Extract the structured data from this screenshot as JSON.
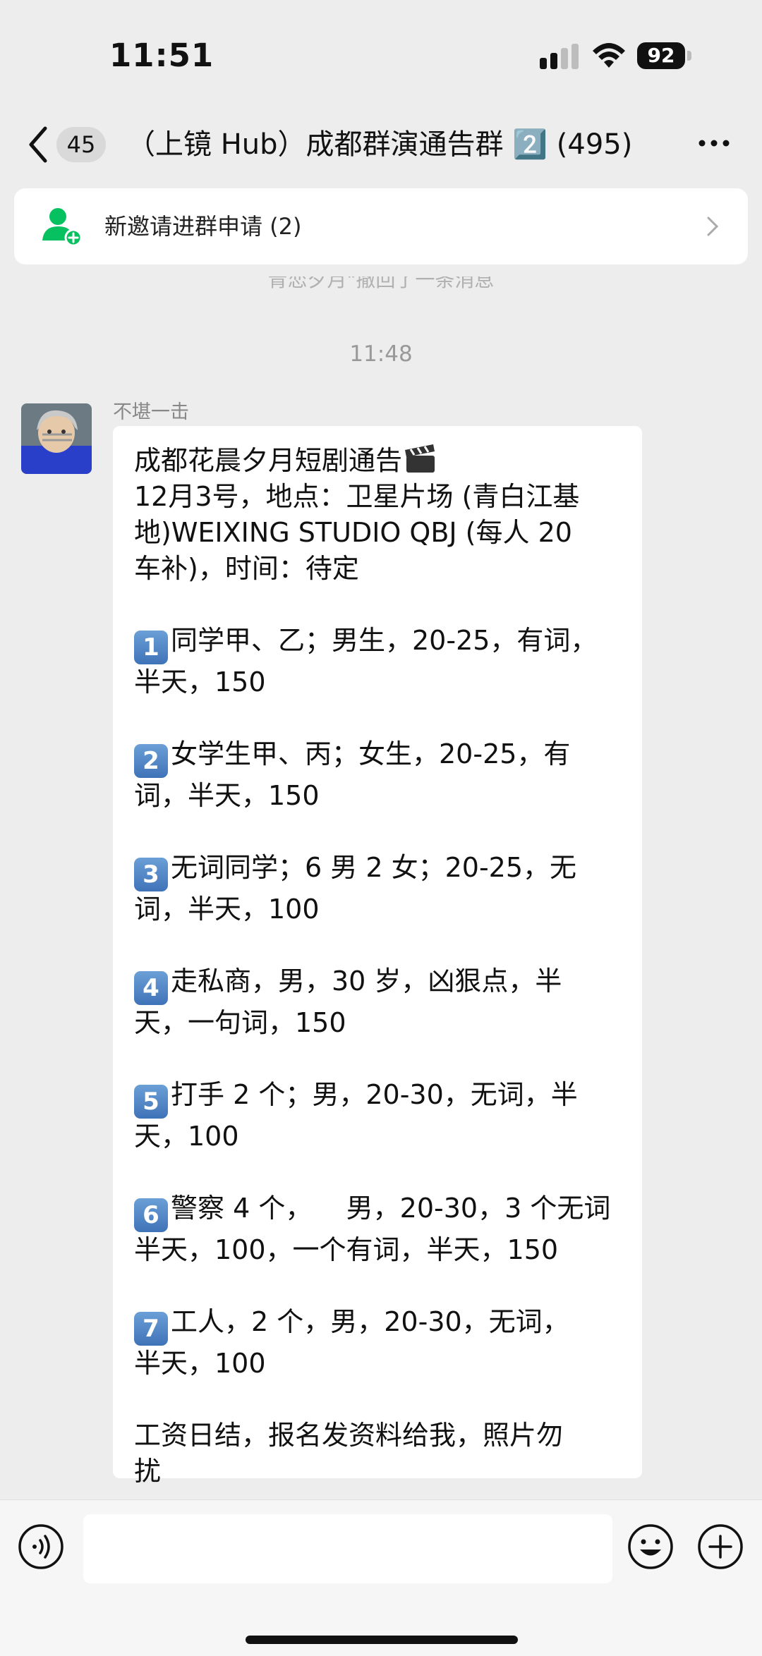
{
  "status_bar": {
    "time": "11:51",
    "battery": "92"
  },
  "nav": {
    "unread_count": "45",
    "title": "（上镜 Hub）成都群演通告群 2️⃣ (495)"
  },
  "invite_banner": {
    "label": "新邀请进群申请 (2)"
  },
  "notice_partial": "青恋夕月\"撤回了一条消息",
  "timestamp": "11:48",
  "message": {
    "sender": "不堪一击",
    "lines": [
      {
        "text": "成都花晨夕月短剧通告",
        "icon": "clapper-icon"
      },
      {
        "text": "12月3号，地点：卫星片场 (青白江基"
      },
      {
        "text": "地)WEIXING STUDIO QBJ (每人 20"
      },
      {
        "text": "车补)，时间：待定"
      },
      {
        "text": ""
      },
      {
        "num": "1",
        "text": "同学甲、乙；男生，20-25，有词，"
      },
      {
        "text": "半天，150"
      },
      {
        "text": ""
      },
      {
        "num": "2",
        "text": "女学生甲、丙；女生，20-25，有"
      },
      {
        "text": "词，半天，150"
      },
      {
        "text": ""
      },
      {
        "num": "3",
        "text": "无词同学；6 男 2 女；20-25，无"
      },
      {
        "text": "词，半天，100"
      },
      {
        "text": ""
      },
      {
        "num": "4",
        "text": "走私商，男，30 岁，凶狠点，半"
      },
      {
        "text": "天，一句词，150"
      },
      {
        "text": ""
      },
      {
        "num": "5",
        "text": "打手 2 个；男，20-30，无词，半"
      },
      {
        "text": "天，100"
      },
      {
        "text": ""
      },
      {
        "num": "6",
        "text": "警察 4 个，    男，20-30，3 个无词"
      },
      {
        "text": "半天，100，一个有词，半天，150"
      },
      {
        "text": ""
      },
      {
        "num": "7",
        "text": "工人，2 个，男，20-30，无词，"
      },
      {
        "text": "半天，100"
      },
      {
        "text": ""
      },
      {
        "text": "工资日结，报名发资料给我，照片勿"
      },
      {
        "text": "扰"
      }
    ]
  },
  "input_bar": {
    "placeholder": ""
  },
  "colors": {
    "background": "#ededed",
    "accent_green": "#07c160",
    "bubble": "#ffffff"
  }
}
